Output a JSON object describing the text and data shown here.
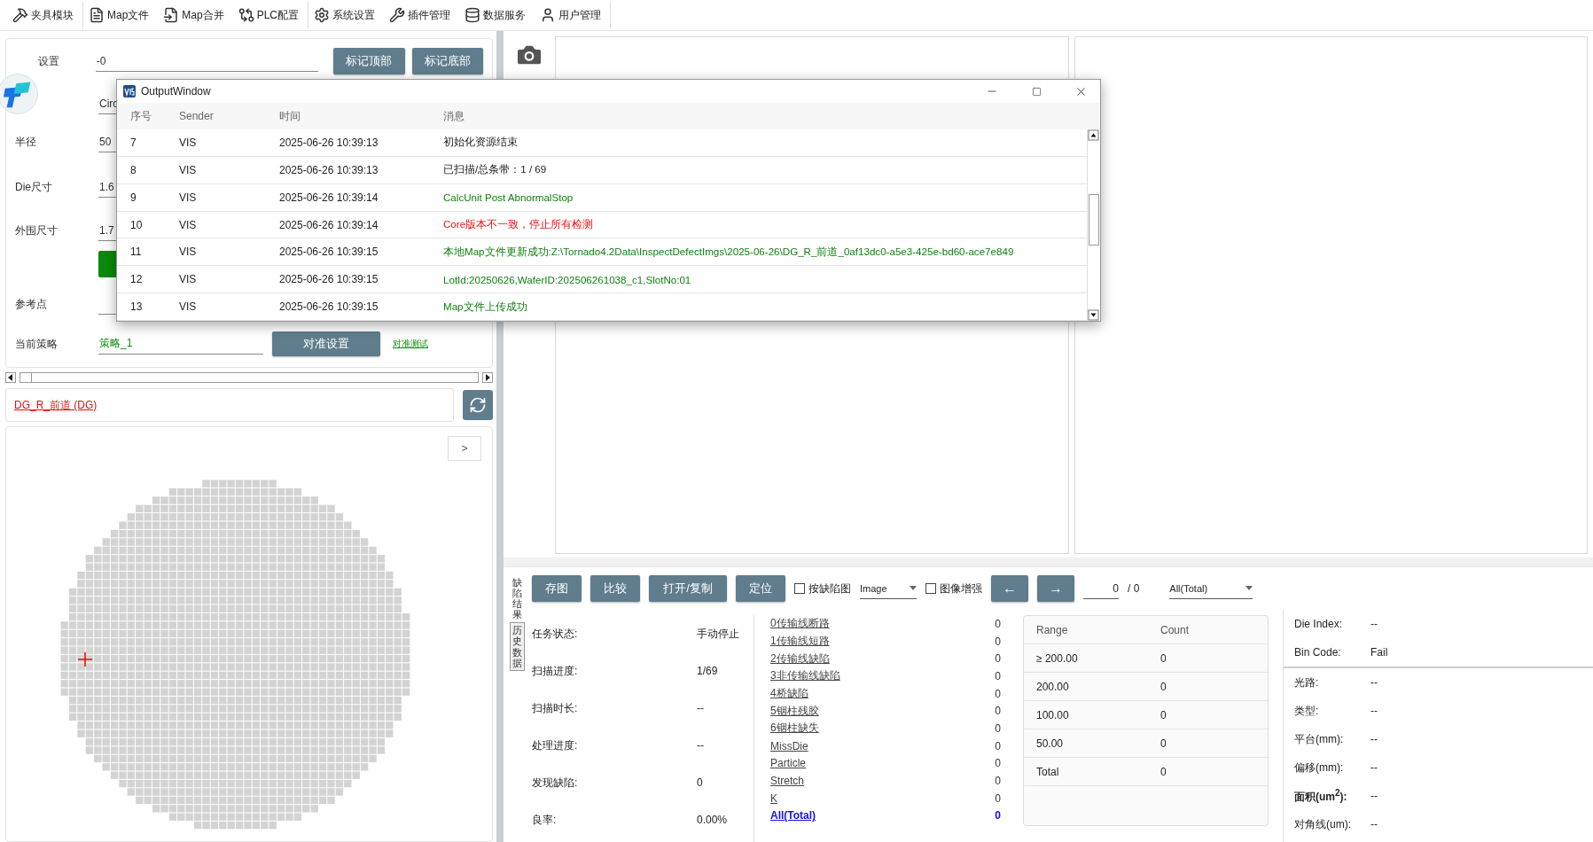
{
  "toolbar": [
    {
      "label": "夹具模块",
      "kind": "clamp",
      "separator": true
    },
    {
      "label": "Map文件",
      "kind": "file",
      "separator": false
    },
    {
      "label": "Map合并",
      "kind": "merge",
      "separator": false
    },
    {
      "label": "PLC配置",
      "kind": "plc",
      "separator": true
    },
    {
      "label": "系统设置",
      "kind": "settings",
      "separator": false
    },
    {
      "label": "插件管理",
      "kind": "tools",
      "separator": false
    },
    {
      "label": "数据服务",
      "kind": "data",
      "separator": false
    },
    {
      "label": "用户管理",
      "kind": "user",
      "separator": true
    }
  ],
  "form": {
    "rows": [
      {
        "kind": "field_buttons",
        "label": "设置",
        "value": "-0",
        "buttons": [
          "标记顶部",
          "标记底部"
        ]
      },
      {
        "kind": "field",
        "value": "Circ"
      },
      {
        "kind": "field",
        "label": "半径",
        "value": "50"
      },
      {
        "kind": "field",
        "label": "Die尺寸",
        "value": "1.6"
      },
      {
        "kind": "field",
        "label": "外围尺寸",
        "value": "1.7"
      },
      {
        "kind": "indicator"
      },
      {
        "kind": "field",
        "label": "参考点"
      },
      {
        "kind": "strategy",
        "label": "当前策略",
        "value": "策略_1",
        "button": "对准设置",
        "link": "对准测试"
      }
    ]
  },
  "recipe": {
    "name": "DG_R_前道 (DG)"
  },
  "wafer_map": {
    "toggle": ">"
  },
  "output_window": {
    "title": "OutputWindow",
    "columns": [
      "序号",
      "Sender",
      "时间",
      "消息"
    ],
    "rows": [
      {
        "index": "7",
        "sender": "VIS",
        "time": "2025-06-26 10:39:13",
        "message": "初始化资源结束",
        "kind": "info"
      },
      {
        "index": "8",
        "sender": "VIS",
        "time": "2025-06-26 10:39:13",
        "message": "已扫描/总条带：1 / 69",
        "kind": "info"
      },
      {
        "index": "9",
        "sender": "VIS",
        "time": "2025-06-26 10:39:14",
        "message": "CalcUnit Post AbnormalStop",
        "kind": "ok"
      },
      {
        "index": "10",
        "sender": "VIS",
        "time": "2025-06-26 10:39:14",
        "message": "Core版本不一致，停止所有检测",
        "kind": "error"
      },
      {
        "index": "11",
        "sender": "VIS",
        "time": "2025-06-26 10:39:15",
        "message": "本地Map文件更新成功:Z:\\Tornado4.2Data\\InspectDefectImgs\\2025-06-26\\DG_R_前道_0af13dc0-a5e3-425e-bd60-ace7e849",
        "kind": "ok"
      },
      {
        "index": "12",
        "sender": "VIS",
        "time": "2025-06-26 10:39:15",
        "message": "LotId:20250626,WaferID:202506261038_c1,SlotNo:01",
        "kind": "ok"
      },
      {
        "index": "13",
        "sender": "VIS",
        "time": "2025-06-26 10:39:15",
        "message": "Map文件上传成功",
        "kind": "ok"
      }
    ]
  },
  "side_tabs": [
    {
      "label": "缺陷结果",
      "selected": true
    },
    {
      "label": "历史数据",
      "selected": false
    }
  ],
  "result_toolbar": {
    "buttons": [
      "存图",
      "比较",
      "打开/复制",
      "定位"
    ],
    "checkbox_1": {
      "label": "按缺陷图",
      "checked": false
    },
    "image_select": "Image",
    "checkbox_2": {
      "label": "图像增强",
      "checked": false
    },
    "arrows": [
      "←",
      "→"
    ],
    "page_field": "0",
    "page_total": "/ 0",
    "filter_select": "All(Total)"
  },
  "stats": [
    {
      "label": "任务状态:",
      "value": "手动停止"
    },
    {
      "label": "扫描进度:",
      "value": "1/69"
    },
    {
      "label": "扫描时长:",
      "value": "--"
    },
    {
      "label": "处理进度:",
      "value": "--"
    },
    {
      "label": "发现缺陷:",
      "value": "0"
    },
    {
      "label": "良率:",
      "value": "0.00%"
    }
  ],
  "defects": [
    {
      "name": "0传输线断路",
      "count": "0",
      "kind": "item"
    },
    {
      "name": "1传输线短路",
      "count": "0",
      "kind": "item"
    },
    {
      "name": "2传输线缺陷",
      "count": "0",
      "kind": "item"
    },
    {
      "name": "3非传输线缺陷",
      "count": "0",
      "kind": "item"
    },
    {
      "name": "4桥缺陷",
      "count": "0",
      "kind": "item"
    },
    {
      "name": "5铟柱残胶",
      "count": "0",
      "kind": "item"
    },
    {
      "name": "6铟柱缺失",
      "count": "0",
      "kind": "item"
    },
    {
      "name": "MissDie",
      "count": "0",
      "kind": "item"
    },
    {
      "name": "Particle",
      "count": "0",
      "kind": "item"
    },
    {
      "name": "Stretch",
      "count": "0",
      "kind": "item"
    },
    {
      "name": "K",
      "count": "0",
      "kind": "item"
    },
    {
      "name": "All(Total)",
      "count": "0",
      "kind": "total"
    }
  ],
  "range_table": {
    "columns": [
      "Range",
      "Count"
    ],
    "rows": [
      [
        "≥ 200.00",
        "0"
      ],
      [
        "200.00",
        "0"
      ],
      [
        "100.00",
        "0"
      ],
      [
        "50.00",
        "0"
      ],
      [
        "Total",
        "0"
      ]
    ]
  },
  "die_info": [
    {
      "label": "Die Index:",
      "value": "--",
      "kind": "head",
      "bold": false
    },
    {
      "label": "Bin Code:",
      "value": "Fail",
      "kind": "head",
      "bold": false
    },
    {
      "label": "光路:",
      "value": "--",
      "kind": "detail",
      "bold": false
    },
    {
      "label": "类型:",
      "value": "--",
      "kind": "detail",
      "bold": false
    },
    {
      "label": "平台(mm):",
      "value": "--",
      "kind": "detail",
      "bold": false
    },
    {
      "label": "偏移(mm):",
      "value": "--",
      "kind": "detail",
      "bold": false
    },
    {
      "label": "面积(um$^{2}$):",
      "value": "--",
      "kind": "detail",
      "bold": true
    },
    {
      "label": "对角线(um):",
      "value": "--",
      "kind": "detail",
      "bold": false
    }
  ]
}
